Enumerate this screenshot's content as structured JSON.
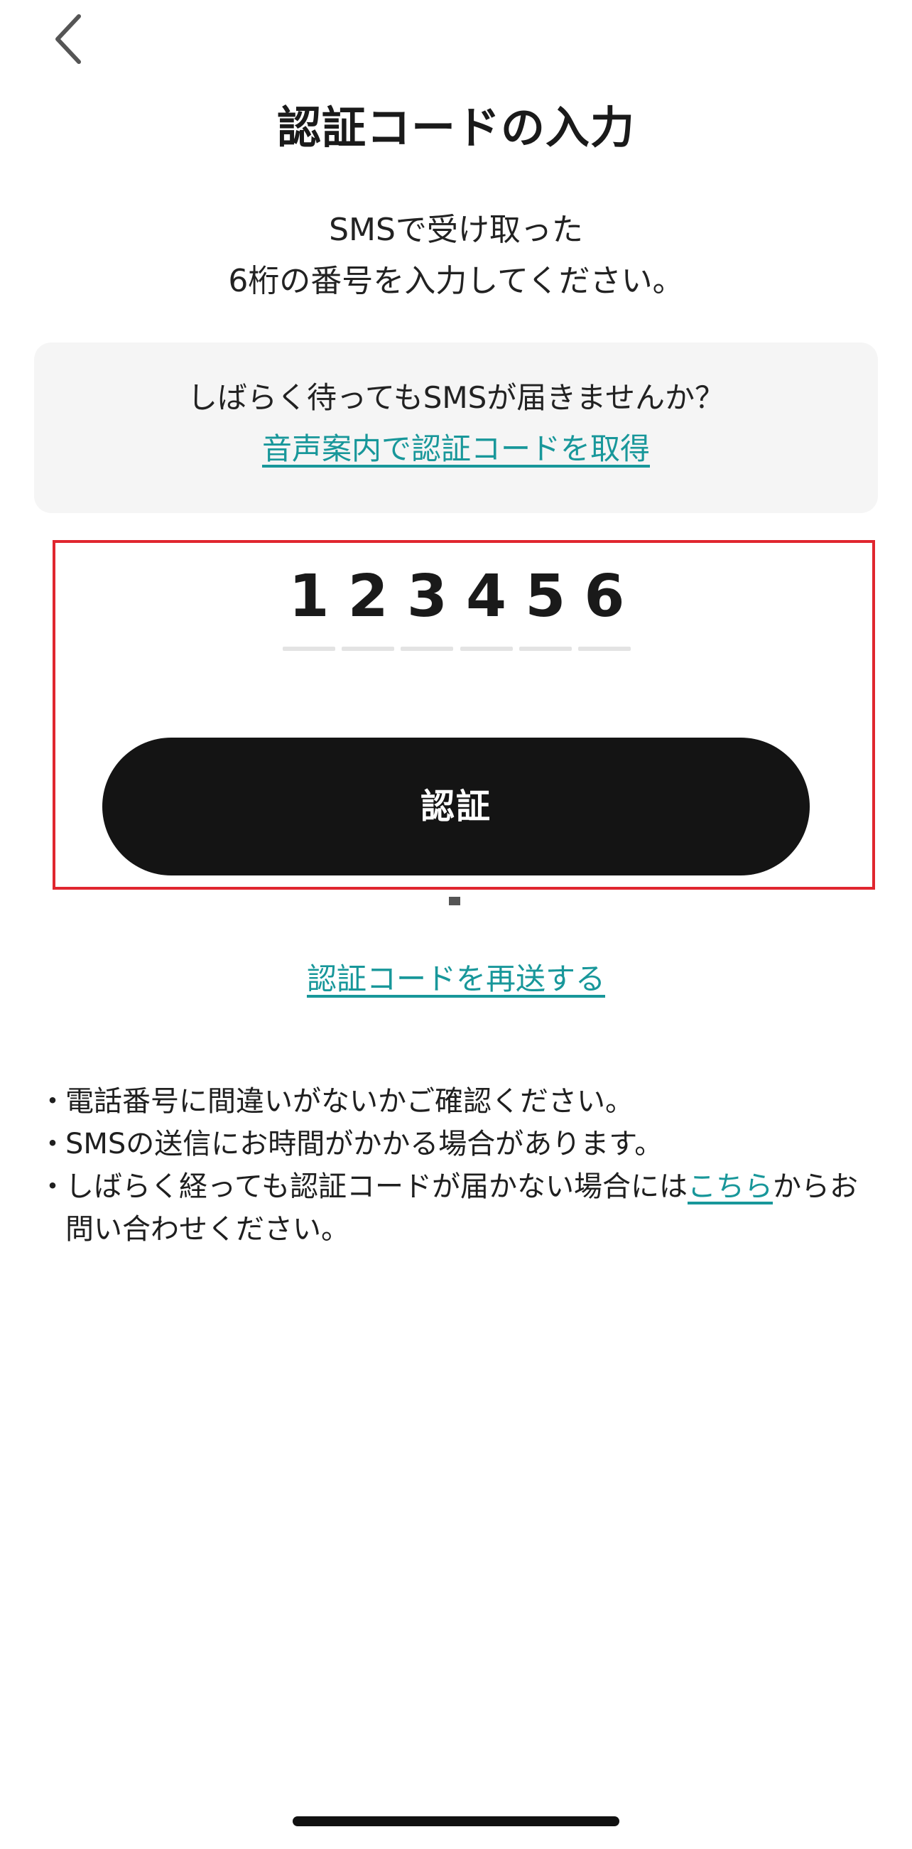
{
  "header": {
    "back_icon": "chevron-left-icon",
    "title": "認証コードの入力"
  },
  "instruction": {
    "line1": "SMSで受け取った",
    "line2": "6桁の番号を入力してください。"
  },
  "notice": {
    "text": "しばらく待ってもSMSが届きませんか？",
    "link": "音声案内で認証コードを取得"
  },
  "code": {
    "digits": [
      "1",
      "2",
      "3",
      "4",
      "5",
      "6"
    ]
  },
  "verify_button": {
    "label": "認証"
  },
  "resend": {
    "label": "認証コードを再送する"
  },
  "notes": {
    "bullet": "・",
    "item1": "電話番号に間違いがないかご確認ください。",
    "item2": "SMSの送信にお時間がかかる場合があります。",
    "item3_before": "しばらく経っても認証コードが届かない場合には",
    "item3_link": "こちら",
    "item3_after": "からお問い合わせください。"
  },
  "colors": {
    "accent": "#18979a",
    "button": "#141414",
    "highlight": "#e0262f",
    "card_background": "#f5f5f5"
  }
}
